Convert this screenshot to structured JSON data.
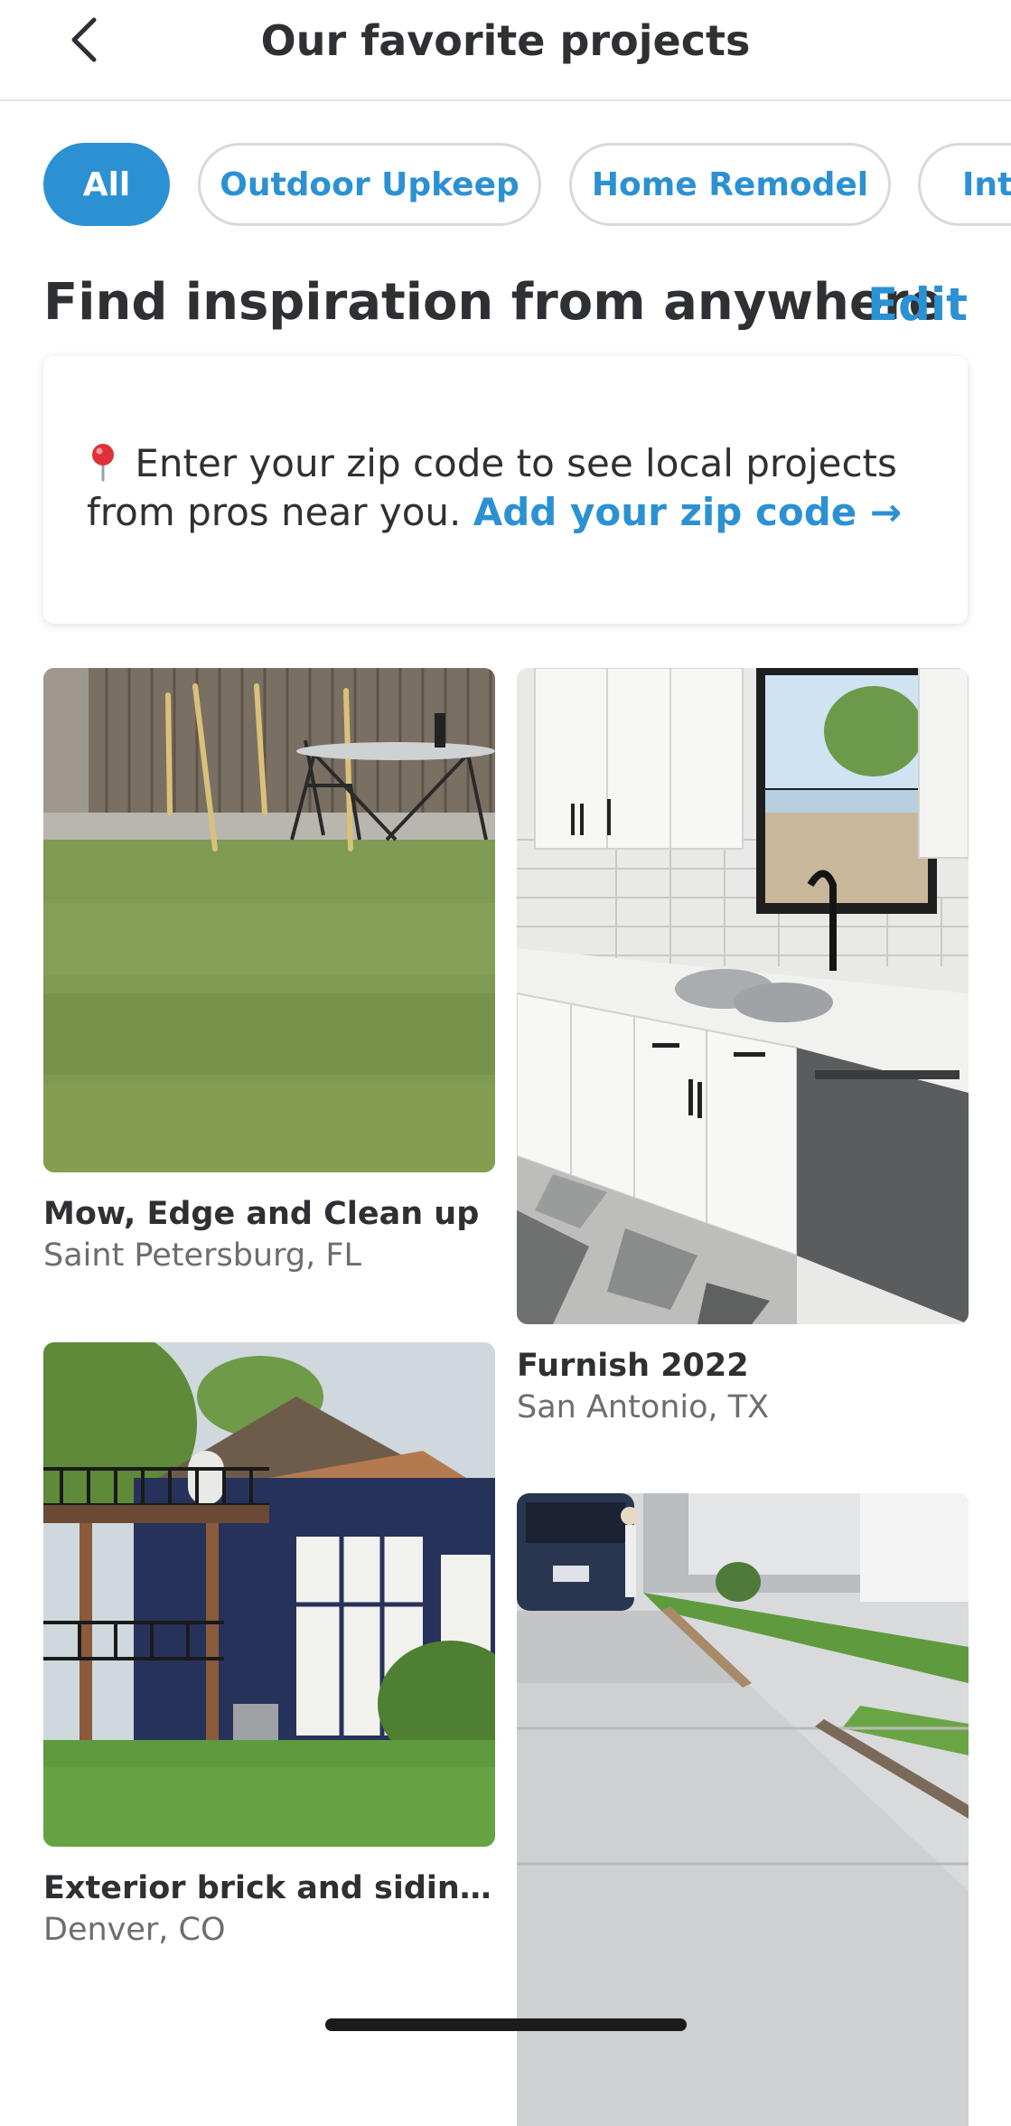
{
  "header": {
    "title": "Our favorite projects"
  },
  "chips": [
    {
      "label": "All",
      "active": true
    },
    {
      "label": "Outdoor Upkeep",
      "active": false
    },
    {
      "label": "Home Remodel",
      "active": false
    },
    {
      "label": "Inte",
      "active": false
    }
  ],
  "section": {
    "title": "Find inspiration from anywhere",
    "edit_label": "Edit"
  },
  "zip_card": {
    "message": "Enter your zip code to see local projects from pros near you.",
    "link_label": "Add your zip code →"
  },
  "projects": [
    {
      "name": "Mow, Edge and Clean up",
      "location": "Saint Petersburg, FL"
    },
    {
      "name": "Furnish 2022",
      "location": "San Antonio, TX"
    },
    {
      "name": "Exterior brick and siding ho...",
      "location": "Denver, CO"
    },
    {
      "name": "",
      "location": ""
    }
  ],
  "colors": {
    "accent": "#2c91d3",
    "text": "#2f3033",
    "muted": "#6b6d72"
  }
}
